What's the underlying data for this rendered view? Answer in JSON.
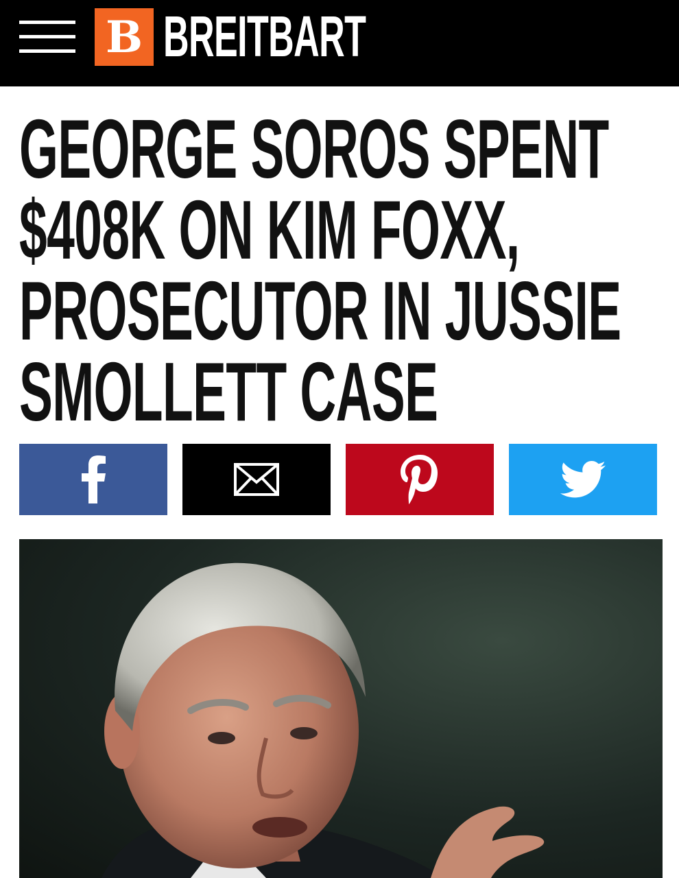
{
  "header": {
    "brand_letter": "B",
    "brand_name": "BREITBART",
    "brand_color": "#f26522"
  },
  "article": {
    "headline": "GEORGE SOROS SPENT $408K ON KIM FOXX, PROSECUTOR IN JUSSIE SMOLLETT CASE"
  },
  "share_buttons": [
    {
      "icon": "facebook-icon",
      "color": "#3b5998"
    },
    {
      "icon": "email-icon",
      "color": "#000000"
    },
    {
      "icon": "pinterest-icon",
      "color": "#bd081c"
    },
    {
      "icon": "twitter-icon",
      "color": "#1da1f2"
    }
  ]
}
